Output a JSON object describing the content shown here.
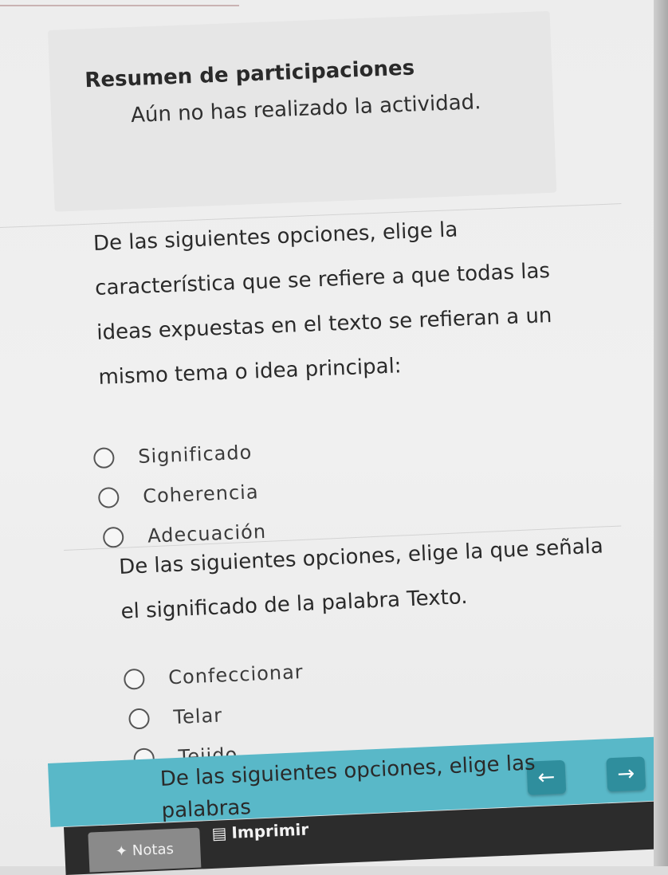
{
  "summary": {
    "title": "Resumen de participaciones",
    "status": "Aún no has realizado la actividad."
  },
  "questions": [
    {
      "lines": [
        "De las siguientes opciones, elige la",
        "característica que se refiere a que todas las",
        "ideas expuestas en el texto se refieran a un",
        "mismo tema o idea principal:"
      ],
      "options": [
        "Significado",
        "Coherencia",
        "Adecuación"
      ]
    },
    {
      "lines": [
        "De las siguientes opciones, elige la que señala",
        "el significado de la palabra Texto."
      ],
      "options": [
        "Confeccionar",
        "Telar",
        "Tejido"
      ]
    },
    {
      "lines": [
        "De las siguientes opciones, elige las palabras"
      ],
      "options": []
    }
  ],
  "nav": {
    "prev_icon": "arrow-left-icon",
    "next_icon": "arrow-right-icon",
    "accent": "#59b8c8"
  },
  "footer": {
    "notes_label": "Notas",
    "print_label": "Imprimir"
  }
}
